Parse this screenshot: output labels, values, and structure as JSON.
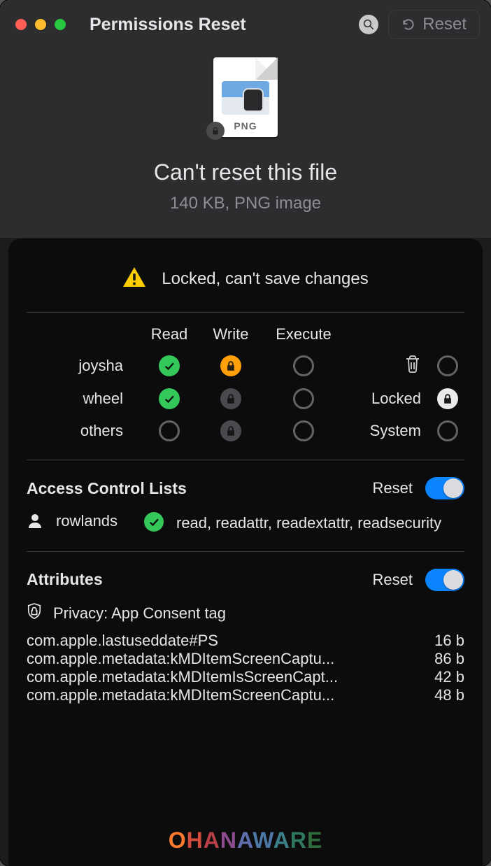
{
  "titlebar": {
    "title": "Permissions Reset",
    "reset_label": "Reset"
  },
  "file": {
    "extension_badge": "PNG",
    "headline": "Can't reset this file",
    "subtitle": "140 KB, PNG image"
  },
  "warning": {
    "message": "Locked, can't save changes"
  },
  "permissions": {
    "columns": {
      "read": "Read",
      "write": "Write",
      "execute": "Execute"
    },
    "rows": [
      {
        "label": "joysha",
        "read": {
          "state": "green-check"
        },
        "write": {
          "state": "orange-lock"
        },
        "execute": {
          "state": "empty"
        }
      },
      {
        "label": "wheel",
        "read": {
          "state": "green-check"
        },
        "write": {
          "state": "grey-lock"
        },
        "execute": {
          "state": "empty"
        }
      },
      {
        "label": "others",
        "read": {
          "state": "empty"
        },
        "write": {
          "state": "grey-lock"
        },
        "execute": {
          "state": "empty"
        }
      }
    ],
    "flags": [
      {
        "icon": "trash",
        "state": "empty"
      },
      {
        "label": "Locked",
        "state": "white-lock"
      },
      {
        "label": "System",
        "state": "empty"
      }
    ]
  },
  "acl": {
    "title": "Access Control Lists",
    "reset_label": "Reset",
    "reset_on": true,
    "entries": [
      {
        "name": "rowlands",
        "state": "green-check",
        "perms": "read, readattr, readextattr, readsecurity"
      }
    ]
  },
  "attributes": {
    "title": "Attributes",
    "reset_label": "Reset",
    "reset_on": true,
    "privacy": "Privacy: App Consent tag",
    "items": [
      {
        "key": "com.apple.lastuseddate#PS",
        "size": "16 b"
      },
      {
        "key": "com.apple.metadata:kMDItemScreenCaptu...",
        "size": "86 b"
      },
      {
        "key": "com.apple.metadata:kMDItemIsScreenCapt...",
        "size": "42 b"
      },
      {
        "key": "com.apple.metadata:kMDItemScreenCaptu...",
        "size": "48 b"
      }
    ]
  },
  "footer": {
    "brand": "OHANAWARE"
  }
}
